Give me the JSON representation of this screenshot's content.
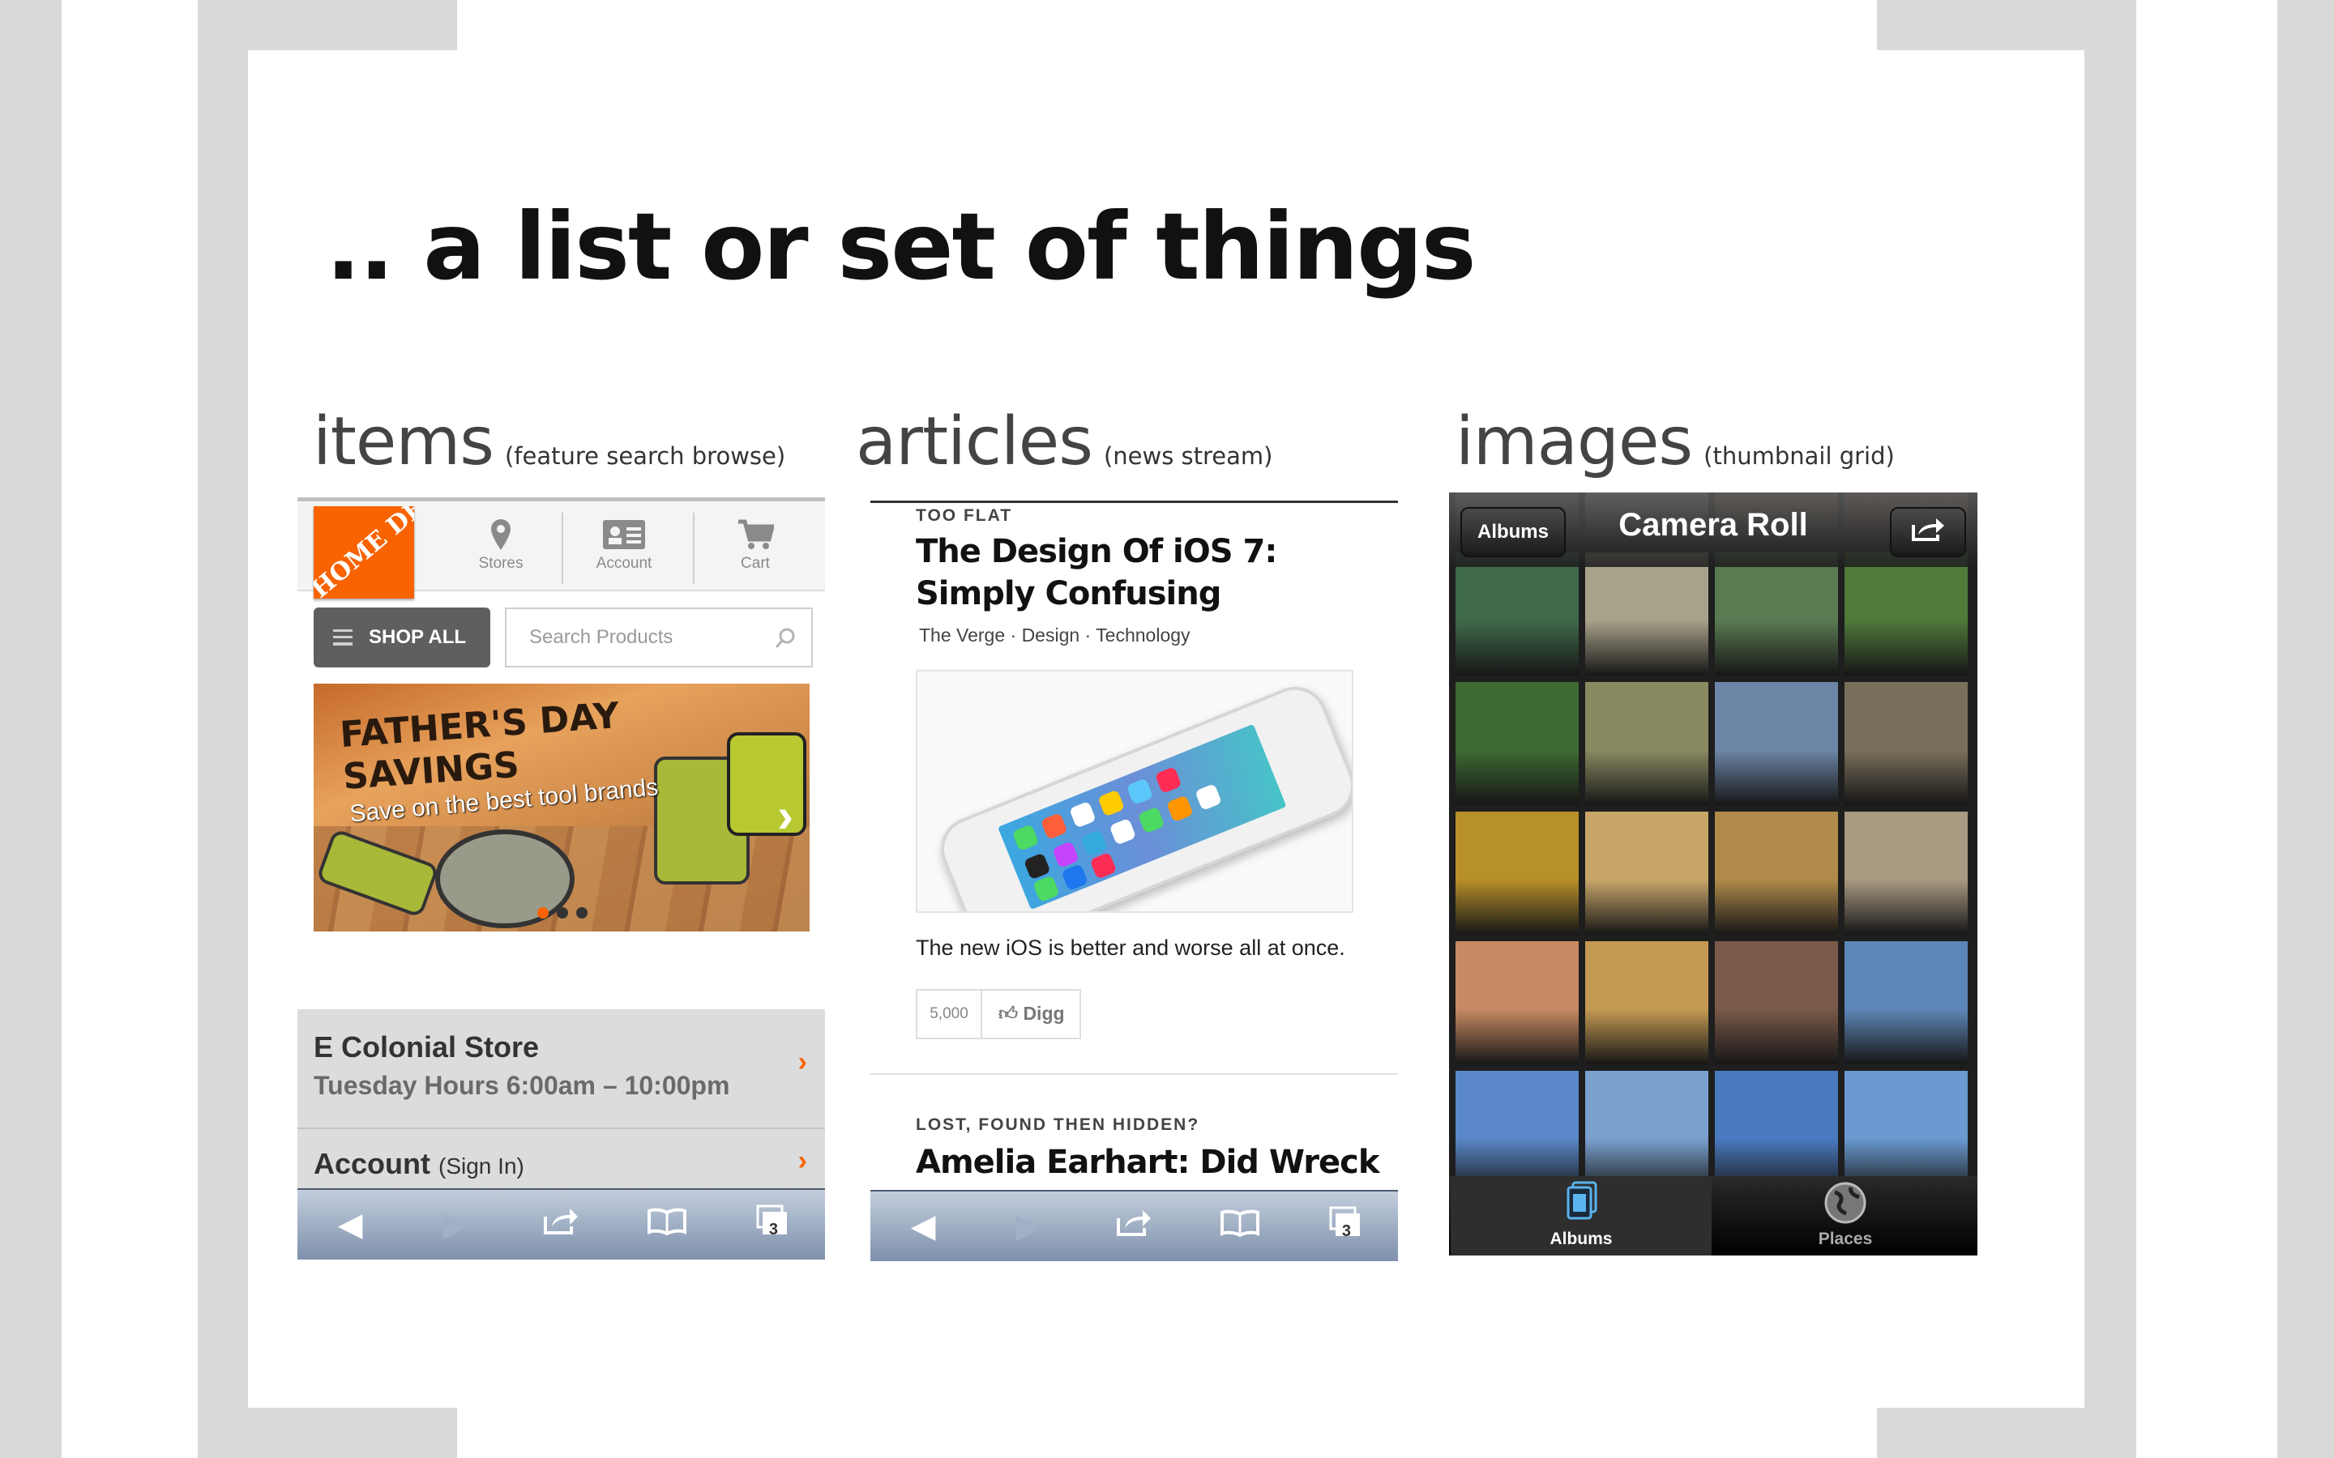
{
  "slide": {
    "title": ".. a list or set of things"
  },
  "columns": [
    {
      "title": "items",
      "subtitle": "(feature search browse)"
    },
    {
      "title": "articles",
      "subtitle": "(news stream)"
    },
    {
      "title": "images",
      "subtitle": "(thumbnail grid)"
    }
  ],
  "homedepot": {
    "logo_text": "THE HOME DEPOT",
    "nav": [
      {
        "label": "Stores",
        "icon": "pin-icon"
      },
      {
        "label": "Account",
        "icon": "card-icon"
      },
      {
        "label": "Cart",
        "icon": "cart-icon"
      }
    ],
    "shop_all": "SHOP ALL",
    "search_placeholder": "Search Products",
    "banner": {
      "line1": "FATHER'S DAY",
      "line2": "SAVINGS",
      "sub": "Save on the best tool brands"
    },
    "store": {
      "name": "E Colonial Store",
      "hours": "Tuesday Hours 6:00am – 10:00pm"
    },
    "account": {
      "label": "Account",
      "sub": "(Sign In)"
    },
    "toolbar_tabs_count": "3"
  },
  "articles": {
    "a1": {
      "kicker": "TOO FLAT",
      "headline_line1": "The Design Of iOS 7:",
      "headline_line2": "Simply Confusing",
      "meta": "The Verge · Design · Technology",
      "dek": "The new iOS is better and worse all at once.",
      "digg_count": "5,000",
      "digg_label": "Digg"
    },
    "a2": {
      "kicker": "LOST, FOUND THEN HIDDEN?",
      "headline": "Amelia Earhart: Did Wreck"
    },
    "toolbar_tabs_count": "3"
  },
  "camera_roll": {
    "back_button": "Albums",
    "title": "Camera Roll",
    "tabs": [
      {
        "label": "Albums",
        "icon": "albums-icon",
        "active": true
      },
      {
        "label": "Places",
        "icon": "globe-icon",
        "active": false
      }
    ],
    "thumb_colors": [
      [
        "#7d6a58",
        "#9a8f84",
        "#8b6a4e",
        "#8a5e44"
      ],
      [
        "#3f6a4a",
        "#a8a28a",
        "#5a7a52",
        "#4f7a3a"
      ],
      [
        "#3d6a32",
        "#8a8a62",
        "#6d86a8",
        "#7a6f5a"
      ],
      [
        "#b8902a",
        "#c8a66a",
        "#b08a4a",
        "#a99a82"
      ],
      [
        "#c88a64",
        "#c49a52",
        "#7a5a4a",
        "#5d86b8"
      ],
      [
        "#5a88c8",
        "#7aa0d0",
        "#4a7ac0",
        "#6a9ad0"
      ]
    ]
  }
}
